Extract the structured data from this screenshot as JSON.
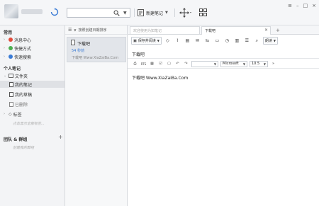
{
  "toolbar": {
    "new_note_label": "新建笔记",
    "search_placeholder": ""
  },
  "sidebar": {
    "section_common": "常用",
    "common_items": [
      {
        "label": "消息中心",
        "icon": "message-center-icon"
      },
      {
        "label": "快捷方式",
        "icon": "shortcut-icon"
      },
      {
        "label": "快速搜索",
        "icon": "quick-search-icon"
      }
    ],
    "section_personal": "个人笔记",
    "folder_label": "文件夹",
    "folder_items": [
      {
        "label": "我的笔记",
        "selected": true
      },
      {
        "label": "我的草稿",
        "selected": false
      },
      {
        "label": "已删除",
        "selected": false
      }
    ],
    "tags_label": "标签",
    "tags_hint": "点击显示全部标签...",
    "section_groups": "团队 & 群组",
    "groups_hint": "创建我的群组"
  },
  "note_list": {
    "sort_label": "按照创建日期排序",
    "notes": [
      {
        "title": "下载吧",
        "time": "54 秒前",
        "preview": "下载吧 Www.XiaZaiBa.Com"
      }
    ]
  },
  "editor": {
    "search_tab_placeholder": "欢迎使用为知笔记",
    "active_tab": "下载吧",
    "save_read_label": "保存并阅读",
    "read_mode_label": "朗读",
    "note_title": "下载吧",
    "font_name": "Microsoft",
    "font_size": "10.5",
    "style_value": "",
    "body": "下载吧 Www.XiaZaiBa.Com"
  },
  "colors": {
    "accent": "#3a7bd5",
    "sidebar_bg": "#f3f4f6",
    "selected_bg": "#dfe1e5"
  }
}
